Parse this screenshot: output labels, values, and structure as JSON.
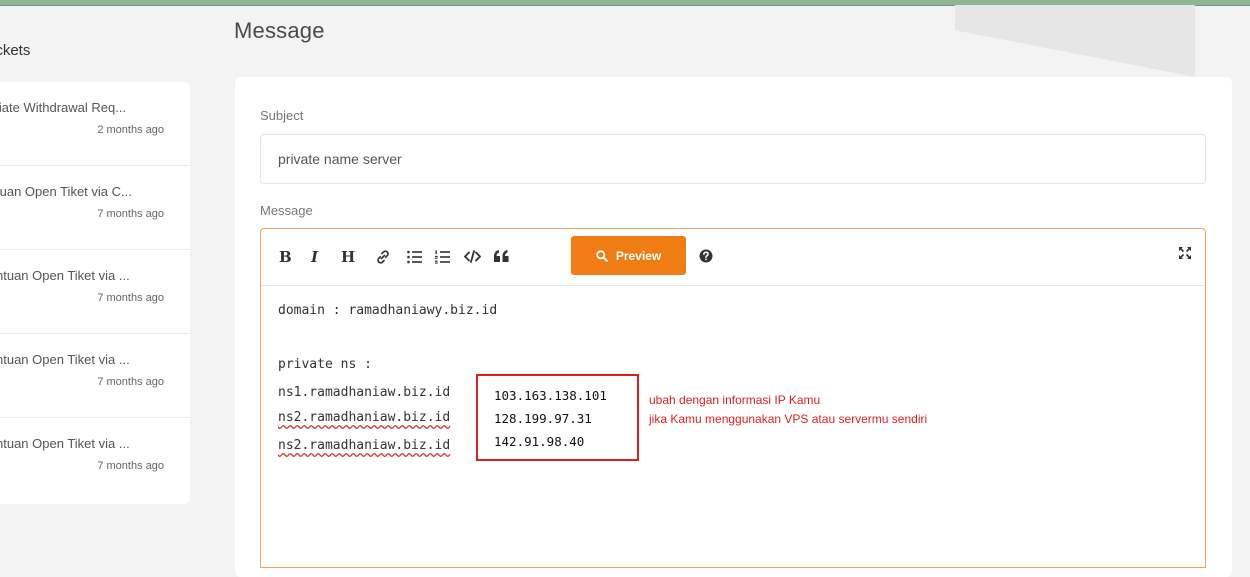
{
  "sidebar": {
    "title": "ickets",
    "tickets": [
      {
        "title": "liate Withdrawal Req...",
        "time": "2 months ago"
      },
      {
        "title": "tuan Open Tiket via C...",
        "time": "7 months ago"
      },
      {
        "title": "ntuan Open Tiket via ...",
        "time": "7 months ago"
      },
      {
        "title": "ntuan Open Tiket via ...",
        "time": "7 months ago"
      },
      {
        "title": "ntuan Open Tiket via ...",
        "time": "7 months ago"
      }
    ]
  },
  "main": {
    "page_title": "Message",
    "subject_label": "Subject",
    "subject_value": "private name server",
    "message_label": "Message",
    "toolbar": {
      "bold": "B",
      "italic": "I",
      "heading": "H",
      "preview_label": "Preview",
      "icons": [
        "link-icon",
        "unordered-list-icon",
        "ordered-list-icon",
        "code-icon",
        "quote-icon",
        "search-icon",
        "help-icon",
        "fullscreen-icon"
      ]
    },
    "editor_lines": {
      "domain": "domain : ramadhaniawy.biz.id",
      "private_ns": "private ns :",
      "ns1": "ns1.ramadhaniaw.biz.id",
      "ns2a": "ns2.ramadhaniaw.biz.id",
      "ns2b": "ns2.ramadhaniaw.biz.id"
    },
    "ip_addresses": [
      "103.163.138.101",
      "128.199.97.31",
      "142.91.98.40"
    ],
    "annotations": {
      "line1": "ubah dengan informasi IP Kamu",
      "line2": "jika Kamu menggunakan VPS atau servermu sendiri"
    },
    "colors": {
      "accent": "#f07d14",
      "highlight": "#e01e1e",
      "top_bar": "#8fb598"
    }
  }
}
